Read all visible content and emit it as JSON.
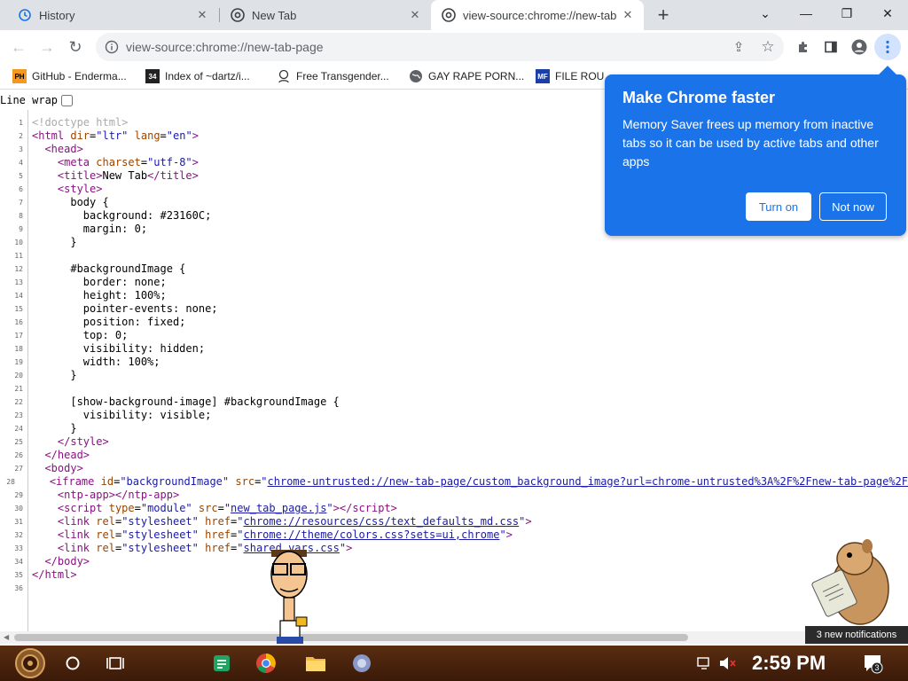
{
  "tabs": [
    {
      "label": "History",
      "icon": "history-icon"
    },
    {
      "label": "New Tab",
      "icon": "chrome-icon"
    },
    {
      "label": "view-source:chrome://new-tab",
      "icon": "chrome-icon",
      "active": true
    }
  ],
  "address_bar": {
    "url": "view-source:chrome://new-tab-page"
  },
  "bookmarks": [
    {
      "label": "GitHub - Enderma..."
    },
    {
      "label": "Index of ~dartz/i..."
    },
    {
      "label": "Free Transgender..."
    },
    {
      "label": "GAY RAPE PORN..."
    },
    {
      "label": "FILE ROU"
    }
  ],
  "bookmark_badges": {
    "ph": "PH",
    "num": "34",
    "mf": "MF"
  },
  "line_wrap": {
    "label": "Line wrap"
  },
  "source_lines": [
    {
      "n": "1",
      "html": "<span class=\"cm\">&lt;!doctype html&gt;</span>"
    },
    {
      "n": "2",
      "html": "<span class=\"tag\">&lt;html</span> <span class=\"an\">dir</span>=<span class=\"av\">\"ltr\"</span> <span class=\"an\">lang</span>=<span class=\"av\">\"en\"</span><span class=\"tag\">&gt;</span>"
    },
    {
      "n": "3",
      "html": "  <span class=\"tag\">&lt;head&gt;</span>"
    },
    {
      "n": "4",
      "html": "    <span class=\"tag\">&lt;meta</span> <span class=\"an\">charset</span>=<span class=\"av\">\"utf-8\"</span><span class=\"tag\">&gt;</span>"
    },
    {
      "n": "5",
      "html": "    <span class=\"tag\">&lt;title&gt;</span>New Tab<span class=\"tag\">&lt;/title&gt;</span>"
    },
    {
      "n": "6",
      "html": "    <span class=\"tag\">&lt;style&gt;</span>"
    },
    {
      "n": "7",
      "html": "      body {"
    },
    {
      "n": "8",
      "html": "        background: #23160C;"
    },
    {
      "n": "9",
      "html": "        margin: 0;"
    },
    {
      "n": "10",
      "html": "      }"
    },
    {
      "n": "11",
      "html": ""
    },
    {
      "n": "12",
      "html": "      #backgroundImage {"
    },
    {
      "n": "13",
      "html": "        border: none;"
    },
    {
      "n": "14",
      "html": "        height: 100%;"
    },
    {
      "n": "15",
      "html": "        pointer-events: none;"
    },
    {
      "n": "16",
      "html": "        position: fixed;"
    },
    {
      "n": "17",
      "html": "        top: 0;"
    },
    {
      "n": "18",
      "html": "        visibility: hidden;"
    },
    {
      "n": "19",
      "html": "        width: 100%;"
    },
    {
      "n": "20",
      "html": "      }"
    },
    {
      "n": "21",
      "html": ""
    },
    {
      "n": "22",
      "html": "      [show-background-image] #backgroundImage {"
    },
    {
      "n": "23",
      "html": "        visibility: visible;"
    },
    {
      "n": "24",
      "html": "      }"
    },
    {
      "n": "25",
      "html": "    <span class=\"tag\">&lt;/style&gt;</span>"
    },
    {
      "n": "26",
      "html": "  <span class=\"tag\">&lt;/head&gt;</span>"
    },
    {
      "n": "27",
      "html": "  <span class=\"tag\">&lt;body&gt;</span>"
    },
    {
      "n": "28",
      "html": "    <span class=\"tag\">&lt;iframe</span> <span class=\"an\">id</span>=<span class=\"av\">\"backgroundImage\"</span> <span class=\"an\">src</span>=<span class=\"av\">\"<span class=\"lk\">chrome-untrusted://new-tab-page/custom_background_image?url=chrome-untrusted%3A%2F%2Fnew-tab-page%2F</span>"
    },
    {
      "n": "29",
      "html": "    <span class=\"tag\">&lt;ntp-app&gt;&lt;/ntp-app&gt;</span>"
    },
    {
      "n": "30",
      "html": "    <span class=\"tag\">&lt;script</span> <span class=\"an\">type</span>=<span class=\"av\">\"module\"</span> <span class=\"an\">src</span>=<span class=\"av\">\"<span class=\"lk\">new_tab_page.js</span>\"</span><span class=\"tag\">&gt;&lt;/script&gt;</span>"
    },
    {
      "n": "31",
      "html": "    <span class=\"tag\">&lt;link</span> <span class=\"an\">rel</span>=<span class=\"av\">\"stylesheet\"</span> <span class=\"an\">href</span>=<span class=\"av\">\"<span class=\"lk\">chrome://resources/css/text_defaults_md.css</span>\"</span><span class=\"tag\">&gt;</span>"
    },
    {
      "n": "32",
      "html": "    <span class=\"tag\">&lt;link</span> <span class=\"an\">rel</span>=<span class=\"av\">\"stylesheet\"</span> <span class=\"an\">href</span>=<span class=\"av\">\"<span class=\"lk\">chrome://theme/colors.css?sets=ui,chrome</span>\"</span><span class=\"tag\">&gt;</span>"
    },
    {
      "n": "33",
      "html": "    <span class=\"tag\">&lt;link</span> <span class=\"an\">rel</span>=<span class=\"av\">\"stylesheet\"</span> <span class=\"an\">href</span>=<span class=\"av\">\"<span class=\"lk\">shared_vars.css</span>\"</span><span class=\"tag\">&gt;</span>"
    },
    {
      "n": "34",
      "html": "  <span class=\"tag\">&lt;/body&gt;</span>"
    },
    {
      "n": "35",
      "html": "<span class=\"tag\">&lt;/html&gt;</span>"
    },
    {
      "n": "36",
      "html": ""
    }
  ],
  "bubble": {
    "title": "Make Chrome faster",
    "body": "Memory Saver frees up memory from inactive tabs so it can be used by active tabs and other apps",
    "turn_on": "Turn on",
    "not_now": "Not now"
  },
  "notification": {
    "text": "3 new notifications",
    "count": "3"
  },
  "clock": {
    "time": "2:59 PM"
  },
  "colors": {
    "accent": "#1a73e8",
    "tabstrip": "#dee1e6",
    "taskbar": "#4a230e"
  }
}
